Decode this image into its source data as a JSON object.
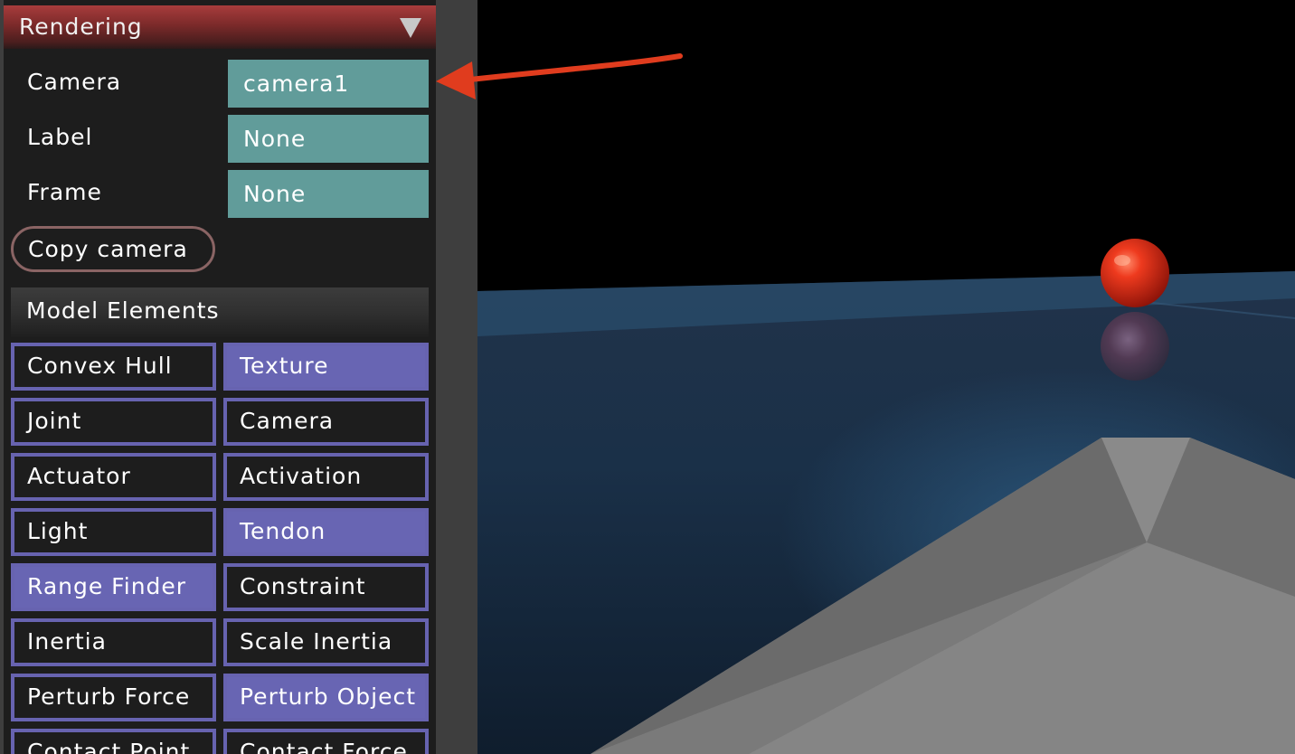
{
  "rendering": {
    "title": "Rendering",
    "collapse_icon": "triangle-down-icon",
    "camera_label": "Camera",
    "camera_value": "camera1",
    "label_label": "Label",
    "label_value": "None",
    "frame_label": "Frame",
    "frame_value": "None",
    "copy_camera": "Copy camera"
  },
  "model_elements": {
    "title": "Model Elements",
    "toggles": [
      {
        "label": "Convex Hull",
        "on": false
      },
      {
        "label": "Texture",
        "on": true
      },
      {
        "label": "Joint",
        "on": false
      },
      {
        "label": "Camera",
        "on": false
      },
      {
        "label": "Actuator",
        "on": false
      },
      {
        "label": "Activation",
        "on": false
      },
      {
        "label": "Light",
        "on": false
      },
      {
        "label": "Tendon",
        "on": true
      },
      {
        "label": "Range Finder",
        "on": true
      },
      {
        "label": "Constraint",
        "on": false
      },
      {
        "label": "Inertia",
        "on": false
      },
      {
        "label": "Scale Inertia",
        "on": false
      },
      {
        "label": "Perturb Force",
        "on": false
      },
      {
        "label": "Perturb Object",
        "on": true
      },
      {
        "label": "Contact Point",
        "on": false
      },
      {
        "label": "Contact Force",
        "on": false
      }
    ]
  },
  "colors": {
    "header_red": "#a83c3c",
    "teal": "#619c9a",
    "toggle_on": "#6865b3",
    "annotation_arrow": "#e03c1e"
  }
}
